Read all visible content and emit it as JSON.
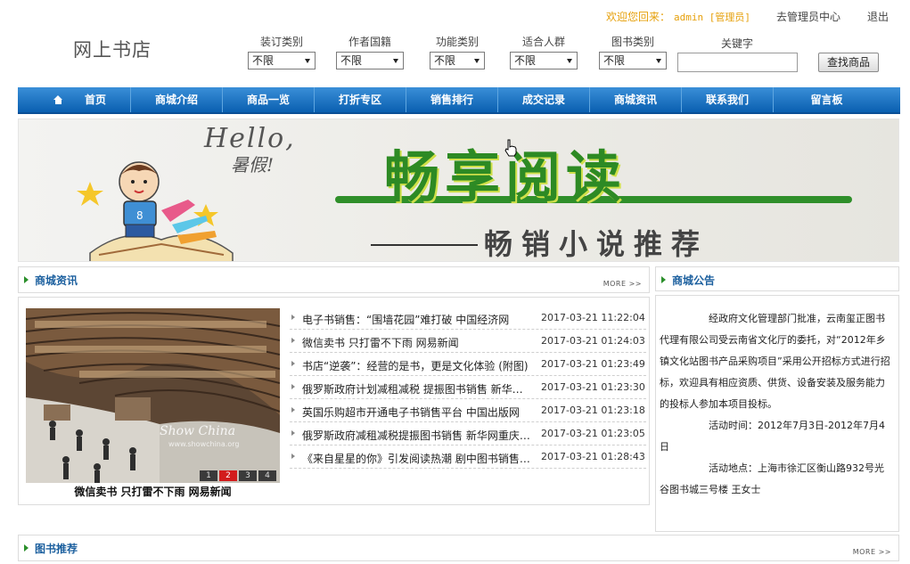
{
  "topbar": {
    "welcome": "欢迎您回来：",
    "username": "admin [管理员]",
    "admin_center": "去管理员中心",
    "logout": "退出"
  },
  "site": {
    "logo": "网上书店"
  },
  "filters": [
    {
      "label": "装订类别",
      "value": "不限"
    },
    {
      "label": "作者国籍",
      "value": "不限"
    },
    {
      "label": "功能类别",
      "value": "不限"
    },
    {
      "label": "适合人群",
      "value": "不限"
    },
    {
      "label": "图书类别",
      "value": "不限"
    }
  ],
  "search": {
    "keyword_label": "关键字",
    "keyword_value": "",
    "button": "查找商品"
  },
  "nav": [
    "首页",
    "商城介绍",
    "商品一览",
    "打折专区",
    "销售排行",
    "成交记录",
    "商城资讯",
    "联系我们",
    "留言板"
  ],
  "banner": {
    "hello": "Hello,",
    "vacation": "暑假!",
    "title": "畅享阅读",
    "subtitle": "畅销小说推荐"
  },
  "news": {
    "title": "商城资讯",
    "more": "MORE >>",
    "caption": "微信卖书 只打雷不下雨 网易新闻",
    "watermark": "Show China",
    "watermark_url": "www.showchina.org",
    "pages": [
      "1",
      "2",
      "3",
      "4"
    ],
    "active_page": 2,
    "items": [
      {
        "title": "电子书销售：“围墙花园”难打破 中国经济网",
        "date": "2017-03-21 11:22:04"
      },
      {
        "title": "微信卖书 只打雷不下雨 网易新闻",
        "date": "2017-03-21 01:24:03"
      },
      {
        "title": "书店“逆袭”：经营的是书，更是文化体验 (附图)",
        "date": "2017-03-21 01:23:49"
      },
      {
        "title": "俄罗斯政府计划减租减税 提振图书销售 新华网重庆",
        "date": "2017-03-21 01:23:30"
      },
      {
        "title": "英国乐购超市开通电子书销售平台 中国出版网",
        "date": "2017-03-21 01:23:18"
      },
      {
        "title": "俄罗斯政府减租减税提振图书销售 新华网重庆频道",
        "date": "2017-03-21 01:23:05"
      },
      {
        "title": "《来自星星的你》引发阅读热潮 剧中图书销售激增",
        "date": "2017-03-21 01:28:43"
      }
    ]
  },
  "notice": {
    "title": "商城公告",
    "p1": "经政府文化管理部门批准，云南玺正图书代理有限公司受云南省文化厅的委托，对“2012年乡镇文化站图书产品采购项目”采用公开招标方式进行招标，欢迎具有相应资质、供货、设备安装及服务能力的投标人参加本项目投标。",
    "p2": "活动时间：2012年7月3日-2012年7月4日",
    "p3": "活动地点：上海市徐汇区衡山路932号光谷图书城三号楼 王女士"
  },
  "recommend": {
    "title": "图书推荐",
    "more": "MORE >>"
  }
}
